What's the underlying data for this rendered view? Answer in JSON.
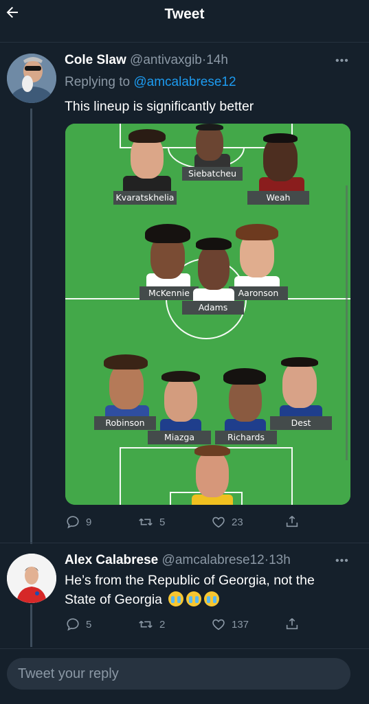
{
  "header": {
    "title": "Tweet"
  },
  "tweet1": {
    "name": "Cole Slaw",
    "handle": "@antivaxgib",
    "sep": "·",
    "time": "14h",
    "replying_prefix": "Replying to ",
    "replying_handle": "@amcalabrese12",
    "text": "This lineup is significantly better",
    "players": {
      "kvaratskhelia": "Kvaratskhelia",
      "siebatcheu": "Siebatcheu",
      "weah": "Weah",
      "mckennie": "McKennie",
      "aaronson": "Aaronson",
      "adams": "Adams",
      "robinson": "Robinson",
      "miazga": "Miazga",
      "richards": "Richards",
      "dest": "Dest"
    },
    "replies": "9",
    "retweets": "5",
    "likes": "23"
  },
  "tweet2": {
    "name": "Alex Calabrese",
    "handle": "@amcalabrese12",
    "sep": "·",
    "time": "13h",
    "text": "He’s from the Republic of Georgia, not the State of Georgia",
    "emoji": "😭😭😭",
    "replies": "5",
    "retweets": "2",
    "likes": "137"
  },
  "reply_box": {
    "placeholder": "Tweet your reply"
  },
  "colors": {
    "background": "#15202b",
    "accent": "#1d9bf0",
    "muted": "#8b98a5",
    "pitch": "#43a849"
  },
  "icons": [
    "back-arrow-icon",
    "reply-icon",
    "retweet-icon",
    "like-icon",
    "share-icon",
    "more-icon"
  ]
}
